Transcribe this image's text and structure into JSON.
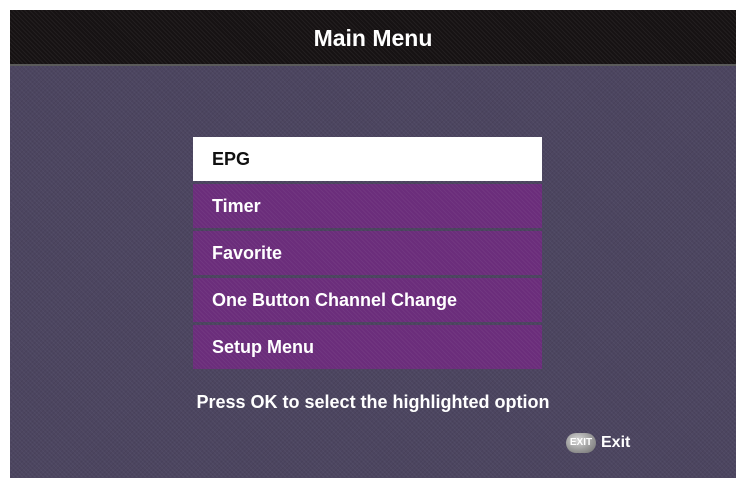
{
  "header": {
    "title": "Main Menu"
  },
  "menu": {
    "selected_index": 0,
    "items": [
      {
        "label": "EPG"
      },
      {
        "label": "Timer"
      },
      {
        "label": "Favorite"
      },
      {
        "label": "One Button Channel Change"
      },
      {
        "label": "Setup Menu"
      }
    ]
  },
  "footer": {
    "hint": "Press OK to select the highlighted option",
    "exit_icon_text": "EXIT",
    "exit_label": "Exit"
  },
  "colors": {
    "background": "#4c4560",
    "title_bar": "#161213",
    "menu_item": "#6b2d7b",
    "menu_item_selected": "#ffffff"
  }
}
